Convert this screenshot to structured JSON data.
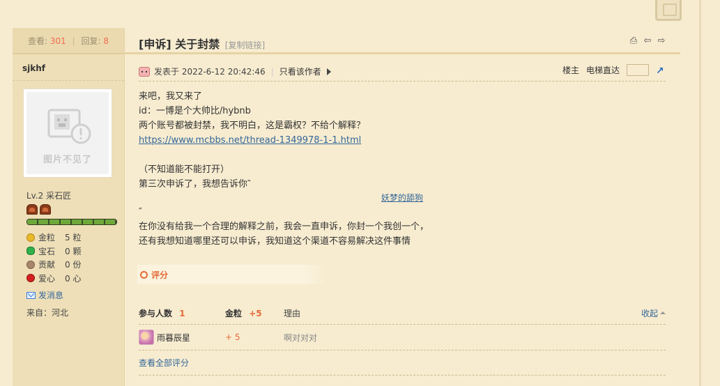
{
  "thread": {
    "views_label": "查看:",
    "views": "301",
    "replies_label": "回复:",
    "replies": "8",
    "title": "[申诉] 关于封禁",
    "copy_link": "[复制链接]"
  },
  "author": {
    "name": "sjkhf",
    "avatar_caption": "图片不见了",
    "level": "Lv.2 采石匠",
    "exp_progress": 1.0,
    "props": [
      {
        "icon": "gold-nugget-icon",
        "name": "金粒",
        "value": "5 粒",
        "color": "#e8b92a"
      },
      {
        "icon": "gem-icon",
        "name": "宝石",
        "value": "0 颗",
        "color": "#2fb04a"
      },
      {
        "icon": "contribution-icon",
        "name": "贡献",
        "value": "0 份",
        "color": "#a9876b"
      },
      {
        "icon": "apple-icon",
        "name": "爱心",
        "value": "0 心",
        "color": "#d42020"
      }
    ],
    "send_message": "发消息",
    "from": "来自：河北"
  },
  "post": {
    "posted_at": "发表于 2022-6-12 20:42:46",
    "only_author": "只看该作者",
    "floor_owner": "楼主",
    "elevator": "电梯直达",
    "lines": [
      "来吧，我又来了",
      "id：一博是个大帅比/hybnb",
      "两个账号都被封禁，我不明白，这是霸权？不给个解释？"
    ],
    "link": "https://www.mcbbs.net/thread-1349978-1-1.html",
    "line_paren": "（不知道能不能打开）",
    "line_third": "第三次申诉了，我想告诉你‶",
    "quote_link": "妖梦的舔狗",
    "line_close_quote": "″",
    "line_a": "在你没有给我一个合理的解释之前，我会一直申诉，你封一个我创一个，",
    "line_b": "还有我想知道哪里还可以申诉，我知道这个渠道不容易解决这件事情"
  },
  "rating": {
    "tab_label": "评分",
    "participants_label": "参与人数",
    "participants": "1",
    "gold_label": "金粒",
    "gold_total": "+5",
    "reason_label": "理由",
    "collapse": "收起",
    "rows": [
      {
        "user": "雨暮辰星",
        "gold": "+ 5",
        "reason": "啊对对对"
      }
    ],
    "view_all": "查看全部评分"
  }
}
